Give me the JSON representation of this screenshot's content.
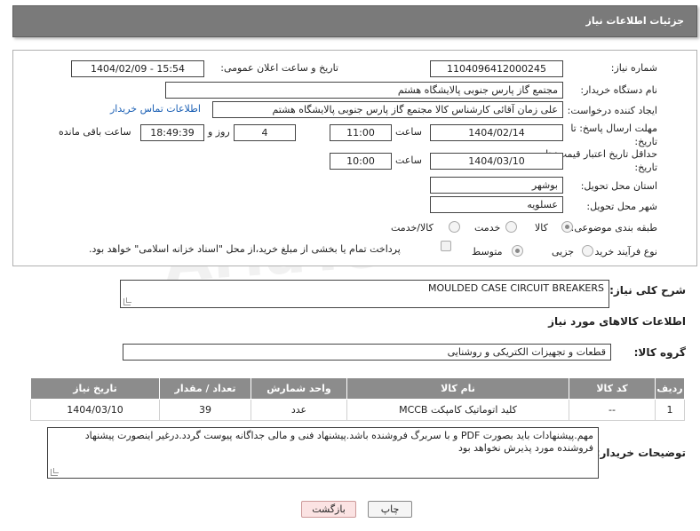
{
  "header": {
    "title": "جزئیات اطلاعات نیاز"
  },
  "fields": {
    "need_number": {
      "label": "شماره نیاز:",
      "value": "1104096412000245"
    },
    "announce_datetime": {
      "label": "تاریخ و ساعت اعلان عمومی:",
      "value": "1404/02/09 - 15:54"
    },
    "buyer_org": {
      "label": "نام دستگاه خریدار:",
      "value": "مجتمع گاز پارس جنوبی  پالایشگاه هشتم"
    },
    "requester": {
      "label": "ایجاد کننده درخواست:",
      "value": "علی زمان آقائی کارشناس کالا مجتمع گاز پارس جنوبی  پالایشگاه هشتم"
    },
    "contact_link": "اطلاعات تماس خریدار",
    "deadline": {
      "label": "مهلت ارسال پاسخ: تا تاریخ:",
      "date": "1404/02/14",
      "time_label": "ساعت",
      "time": "11:00",
      "days": "4",
      "days_label": "روز و",
      "remaining": "18:49:39",
      "remaining_label": "ساعت باقی مانده"
    },
    "price_validity": {
      "label": "حداقل تاریخ اعتبار قیمت: تا تاریخ:",
      "date": "1404/03/10",
      "time_label": "ساعت",
      "time": "10:00"
    },
    "province": {
      "label": "استان محل تحویل:",
      "value": "بوشهر"
    },
    "city": {
      "label": "شهر محل تحویل:",
      "value": "عسلویه"
    },
    "category": {
      "label": "طبقه بندی موضوعی:",
      "options": [
        "کالا",
        "خدمت",
        "کالا/خدمت"
      ],
      "selected": "کالا"
    },
    "purchase_type": {
      "label": "نوع فرآیند خرید :",
      "options": [
        "جزیی",
        "متوسط"
      ],
      "selected": "متوسط",
      "payment_note": "پرداخت تمام یا بخشی از مبلغ خرید،از محل \"اسناد خزانه اسلامی\" خواهد بود."
    }
  },
  "general_desc": {
    "label": "شرح کلی نیاز:",
    "value": "MOULDED CASE CIRCUIT BREAKERS"
  },
  "items_section": {
    "title": "اطلاعات کالاهای مورد نیاز"
  },
  "goods_group": {
    "label": "گروه کالا:",
    "value": "قطعات و تجهیزات الکتریکی و روشنایی"
  },
  "table": {
    "headers": [
      "ردیف",
      "کد کالا",
      "نام کالا",
      "واحد شمارش",
      "تعداد / مقدار",
      "تاریخ نیاز"
    ],
    "rows": [
      [
        "1",
        "--",
        "کلید اتوماتیک کامپکت MCCB",
        "عدد",
        "39",
        "1404/03/10"
      ]
    ]
  },
  "buyer_notes": {
    "label": "توضیحات خریدار:",
    "value": "مهم.پیشنهادات باید بصورت PDF و با سربرگ فروشنده باشد.پیشنهاد فنی و مالی جداگانه پیوست گردد.درغیر اینصورت پیشنهاد فروشنده مورد پذیرش نخواهد بود"
  },
  "buttons": {
    "print": "چاپ",
    "back": "بازگشت"
  },
  "watermark": "AriaTender.net",
  "colors": {
    "header_bg": "#7a7a7a",
    "table_header_bg": "#8c8c8c",
    "link": "#1a5fb4",
    "back_button_bg": "#fbe3e3"
  }
}
